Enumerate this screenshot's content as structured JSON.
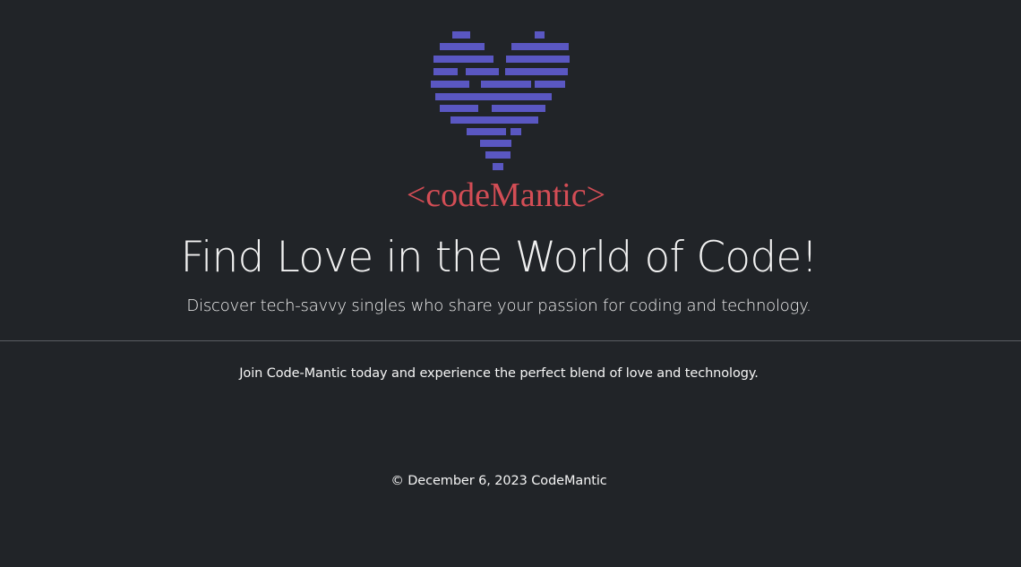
{
  "brand": {
    "logo_text": "<codeMantic>",
    "logo_color": "#d34d55",
    "heart_color": "#5a57c2"
  },
  "hero": {
    "title": "Find Love in the World of Code!",
    "subtitle": "Discover tech-savvy singles who share your passion for coding and technology."
  },
  "content": {
    "tagline": "Join Code-Mantic today and experience the perfect blend of love and technology."
  },
  "footer": {
    "copyright": "© December 6, 2023 CodeMantic"
  },
  "colors": {
    "background": "#212428",
    "text": "#f1f1f1",
    "divider": "#5b5e63"
  }
}
